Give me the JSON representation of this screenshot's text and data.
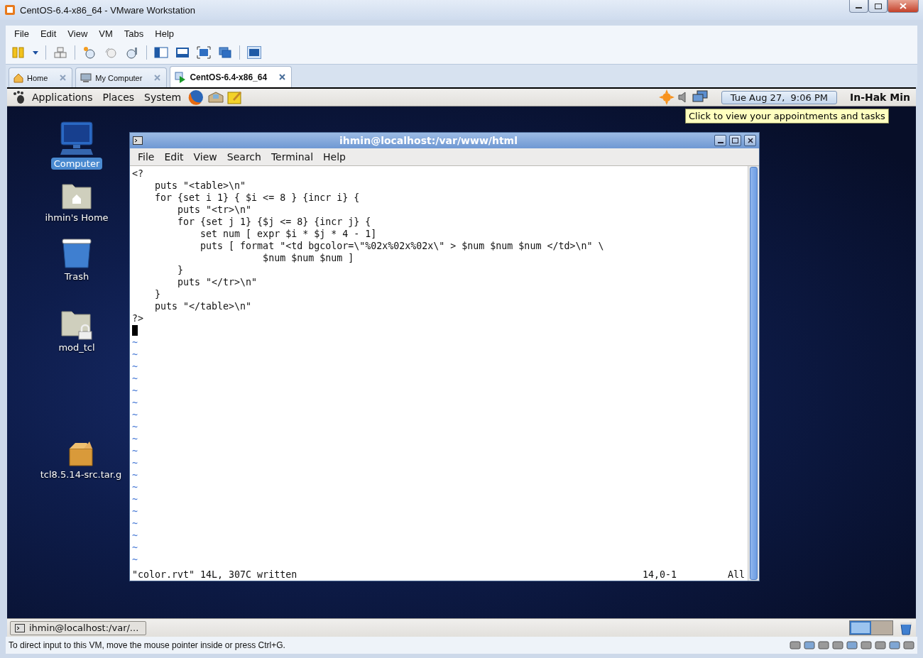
{
  "window": {
    "title": "CentOS-6.4-x86_64 - VMware Workstation"
  },
  "menu": [
    "File",
    "Edit",
    "View",
    "VM",
    "Tabs",
    "Help"
  ],
  "tabs": [
    {
      "label": "Home",
      "selected": false,
      "kind": "home"
    },
    {
      "label": "My Computer",
      "selected": false,
      "kind": "computer"
    },
    {
      "label": "CentOS-6.4-x86_64",
      "selected": true,
      "kind": "vm"
    }
  ],
  "guest": {
    "panel": {
      "menus": [
        "Applications",
        "Places",
        "System"
      ],
      "clock": "Tue Aug 27,  9:06 PM",
      "user": "In-Hak Min",
      "tooltip": "Click to view your appointments and tasks"
    },
    "desktop_icons": [
      {
        "label": "Computer",
        "kind": "computer",
        "selected": true
      },
      {
        "label": "ihmin's Home",
        "kind": "home",
        "selected": false
      },
      {
        "label": "Trash",
        "kind": "trash",
        "selected": false
      },
      {
        "label": "mod_tcl",
        "kind": "locked-folder",
        "selected": false
      },
      {
        "label": "tcl8.5.14-src.tar.g",
        "kind": "package",
        "selected": false
      }
    ],
    "terminal": {
      "title": "ihmin@localhost:/var/www/html",
      "menu": [
        "File",
        "Edit",
        "View",
        "Search",
        "Terminal",
        "Help"
      ],
      "lines": [
        "<?",
        "    puts \"<table>\\n\"",
        "    for {set i 1} { $i <= 8 } {incr i} {",
        "        puts \"<tr>\\n\"",
        "        for {set j 1} {$j <= 8} {incr j} {",
        "            set num [ expr $i * $j * 4 - 1]",
        "            puts [ format \"<td bgcolor=\\\"%02x%02x%02x\\\" > $num $num $num </td>\\n\" \\",
        "                       $num $num $num ]",
        "        }",
        "        puts \"</tr>\\n\"",
        "    }",
        "    puts \"</table>\\n\"",
        "?>"
      ],
      "tildes": [
        "~",
        "~",
        "~",
        "~",
        "~",
        "~",
        "~",
        "~",
        "~",
        "~",
        "~",
        "~",
        "~",
        "~",
        "~",
        "~",
        "~",
        "~",
        "~"
      ],
      "status": {
        "message": "\"color.rvt\" 14L, 307C written",
        "position": "14,0-1",
        "scroll": "All"
      }
    },
    "taskbar": {
      "item": "ihmin@localhost:/var/...",
      "workspaces": [
        {
          "selected": true
        },
        {
          "selected": false
        }
      ]
    }
  },
  "status_bar": {
    "text": "To direct input to this VM, move the mouse pointer inside or press Ctrl+G."
  }
}
